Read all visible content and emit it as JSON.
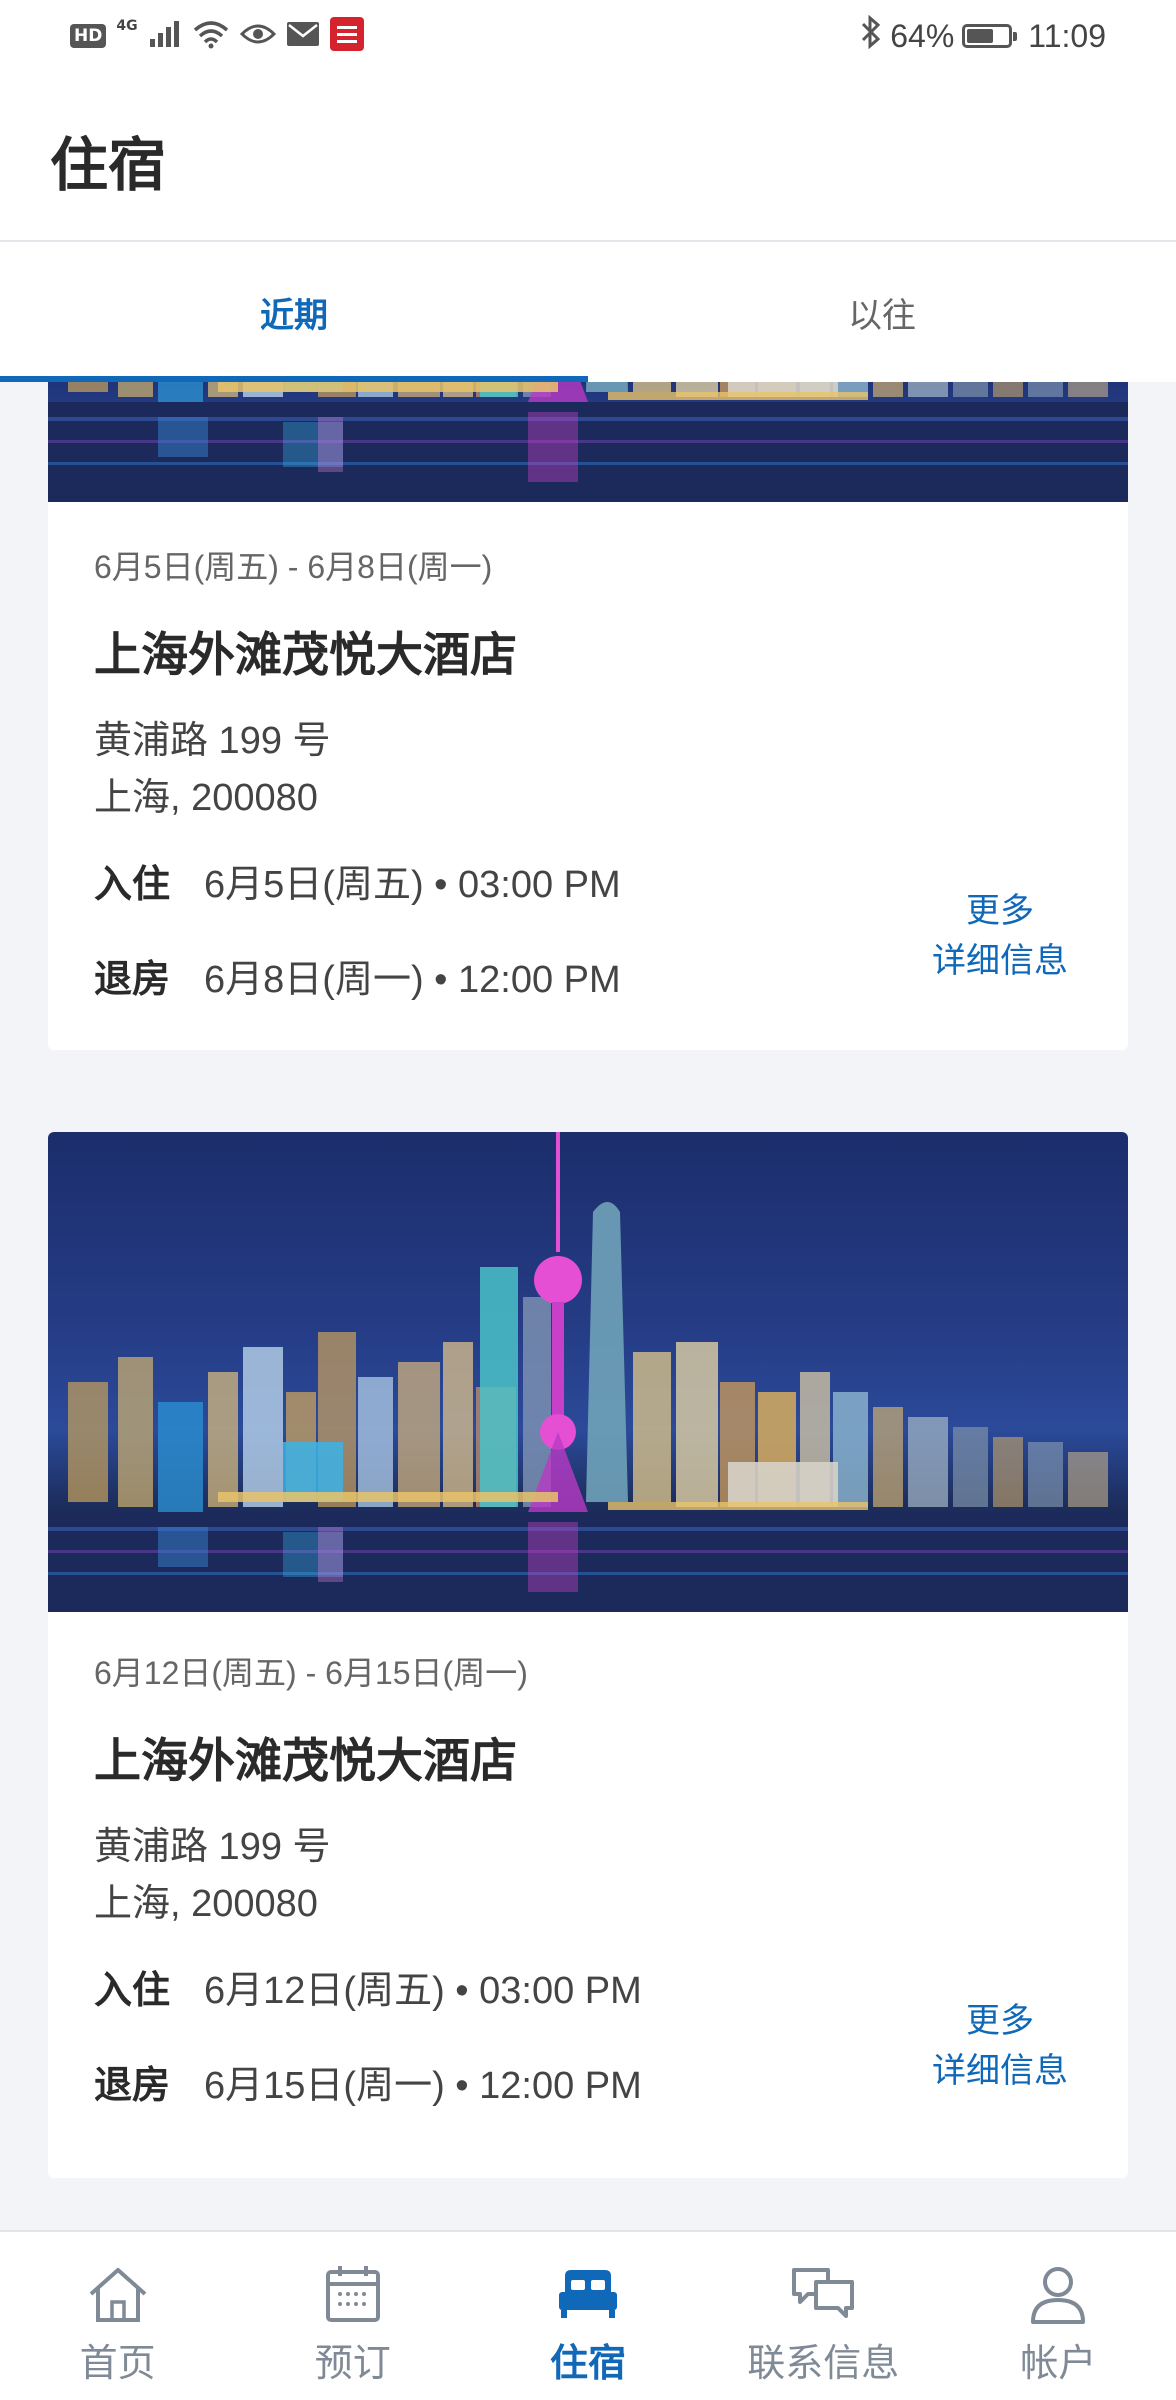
{
  "status_bar": {
    "hd": "HD",
    "network": "4G",
    "battery_percent": "64%",
    "battery_level": 0.64,
    "time": "11:09",
    "icons": [
      "signal-icon",
      "wifi-icon",
      "eye-icon",
      "mail-icon",
      "app-notification-icon",
      "bluetooth-icon",
      "battery-icon"
    ]
  },
  "header": {
    "title": "住宿"
  },
  "tabs": [
    {
      "label": "近期",
      "active": true
    },
    {
      "label": "以往",
      "active": false
    }
  ],
  "stays": [
    {
      "dates": "6月5日(周五) - 6月8日(周一)",
      "hotel": "上海外滩茂悦大酒店",
      "address_line1": "黄浦路 199 号",
      "address_line2": "上海, 200080",
      "checkin_label": "入住",
      "checkin_value": "6月5日(周五) • 03:00 PM",
      "checkout_label": "退房",
      "checkout_value": "6月8日(周一) • 12:00 PM",
      "more_line1": "更多",
      "more_line2": "详细信息"
    },
    {
      "dates": "6月12日(周五) - 6月15日(周一)",
      "hotel": "上海外滩茂悦大酒店",
      "address_line1": "黄浦路 199 号",
      "address_line2": "上海, 200080",
      "checkin_label": "入住",
      "checkin_value": "6月12日(周五) • 03:00 PM",
      "checkout_label": "退房",
      "checkout_value": "6月15日(周一) • 12:00 PM",
      "more_line1": "更多",
      "more_line2": "详细信息"
    }
  ],
  "bottom_nav": [
    {
      "label": "首页",
      "icon": "home-icon",
      "active": false
    },
    {
      "label": "预订",
      "icon": "calendar-icon",
      "active": false
    },
    {
      "label": "住宿",
      "icon": "bed-icon",
      "active": true
    },
    {
      "label": "联系信息",
      "icon": "chat-icon",
      "active": false
    },
    {
      "label": "帐户",
      "icon": "person-icon",
      "active": false
    }
  ],
  "colors": {
    "accent": "#1068b8",
    "background": "#f2f4f7",
    "inactive_nav": "#7f8a96"
  }
}
